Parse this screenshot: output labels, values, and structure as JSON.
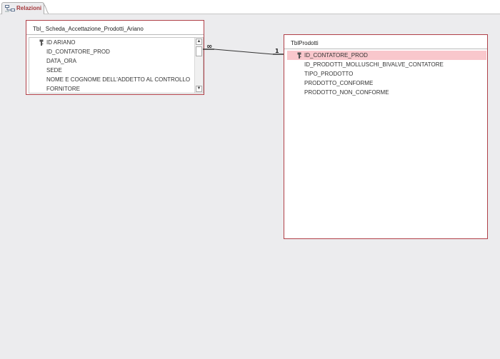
{
  "tab": {
    "label": "Relazioni"
  },
  "tables": [
    {
      "title": "Tbl_ Scheda_Accettazione_Prodotti_Ariano",
      "fields": [
        {
          "name": "ID ARIANO",
          "key": true
        },
        {
          "name": "ID_CONTATORE_PROD",
          "key": false
        },
        {
          "name": "DATA_ORA",
          "key": false
        },
        {
          "name": "SEDE",
          "key": false
        },
        {
          "name": "NOME E COGNOME DELL'ADDETTO AL CONTROLLO",
          "key": false
        },
        {
          "name": "FORNITORE",
          "key": false
        }
      ]
    },
    {
      "title": "TblProdotti",
      "fields": [
        {
          "name": "ID_CONTATORE_PROD",
          "key": true,
          "selected": true
        },
        {
          "name": "ID_PRODOTTI_MOLLUSCHI_BIVALVE_CONTATORE",
          "key": false
        },
        {
          "name": "TIPO_PRODOTTO",
          "key": false
        },
        {
          "name": "PRODOTTO_CONFORME",
          "key": false
        },
        {
          "name": "PRODOTTO_NON_CONFORME",
          "key": false
        }
      ]
    }
  ],
  "relationship": {
    "many_symbol": "∞",
    "one_symbol": "1"
  }
}
